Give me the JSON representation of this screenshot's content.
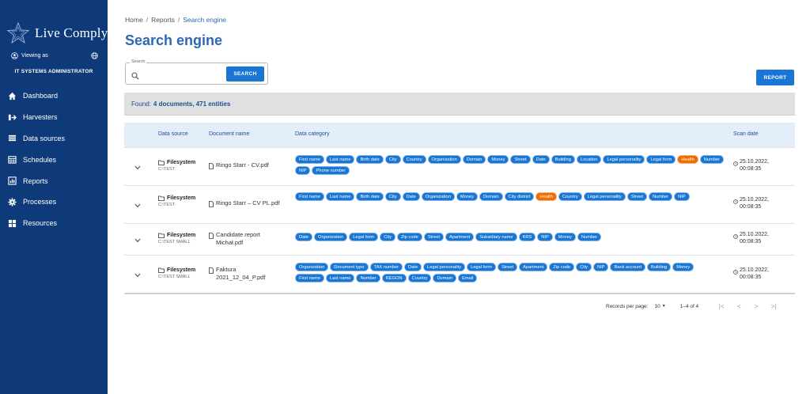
{
  "sidebar": {
    "brand": "Live Comply",
    "viewing_as": "Viewing as",
    "role": "IT SYSTEMS ADMINISTRATOR",
    "items": [
      {
        "label": "Dashboard",
        "icon": "home-icon"
      },
      {
        "label": "Harvesters",
        "icon": "harvesters-icon"
      },
      {
        "label": "Data sources",
        "icon": "list-icon"
      },
      {
        "label": "Schedules",
        "icon": "calendar-icon"
      },
      {
        "label": "Reports",
        "icon": "report-icon"
      },
      {
        "label": "Processes",
        "icon": "gear-icon"
      },
      {
        "label": "Resources",
        "icon": "grid-icon"
      }
    ]
  },
  "breadcrumb": {
    "home": "Home",
    "reports": "Reports",
    "current": "Search engine",
    "sep": "/"
  },
  "page_title": "Search engine",
  "search": {
    "legend": "Search",
    "value": "",
    "button": "SEARCH"
  },
  "report_button": "REPORT",
  "found": {
    "prefix": "Found:",
    "summary": "4 documents, 471 entities"
  },
  "table": {
    "headers": {
      "data_source": "Data source",
      "document_name": "Document name",
      "data_category": "Data category",
      "scan_date": "Scan date"
    },
    "rows": [
      {
        "source": "Filesystem",
        "path": "C:\\TEST",
        "doc_name": "Ringo Starr - CV.pdf",
        "categories": [
          "First name",
          "Last name",
          "Birth date",
          "City",
          "Country",
          "Organization",
          "Domain",
          "Money",
          "Street",
          "Date",
          "Building",
          "Location",
          "Legal personality",
          "Legal form",
          "Health",
          "Number",
          "NIP",
          "Phone number"
        ],
        "scan_date": "25.10.2022,",
        "scan_time": "00:08:35"
      },
      {
        "source": "Filesystem",
        "path": "C:\\TEST",
        "doc_name": "Ringo Starr – CV PL.pdf",
        "categories": [
          "First name",
          "Last name",
          "Birth date",
          "City",
          "Date",
          "Organization",
          "Money",
          "Domain",
          "City district",
          "Health",
          "Country",
          "Legal personality",
          "Street",
          "Number",
          "NIP"
        ],
        "scan_date": "25.10.2022,",
        "scan_time": "00:08:35"
      },
      {
        "source": "Filesystem",
        "path": "C:\\TEST SMALL",
        "doc_name": "Candidate report Michał.pdf",
        "categories": [
          "Date",
          "Organization",
          "Legal form",
          "City",
          "Zip code",
          "Street",
          "Apartment",
          "Subsidiary name",
          "KRS",
          "NIP",
          "Money",
          "Number"
        ],
        "scan_date": "25.10.2022,",
        "scan_time": "00:08:35"
      },
      {
        "source": "Filesystem",
        "path": "C:\\TEST SMALL",
        "doc_name": "Faktura 2021_12_04_P.pdf",
        "categories": [
          "Organization",
          "Document type",
          "TAX number",
          "Date",
          "Legal personality",
          "Legal form",
          "Street",
          "Apartment",
          "Zip code",
          "City",
          "NIP",
          "Bank account",
          "Building",
          "Money",
          "First name",
          "Last name",
          "Number",
          "REGON",
          "Country",
          "Domain",
          "Email"
        ],
        "scan_date": "25.10.2022,",
        "scan_time": "00:08:35"
      }
    ]
  },
  "pagination": {
    "rows_label": "Records per page:",
    "rows_value": "10",
    "range": "1–4 of 4",
    "first": "|<",
    "prev": "<",
    "next": ">",
    "last": ">|"
  },
  "colors": {
    "sidebar": "#0e3a7a",
    "accent": "#1976d2",
    "title": "#2d68b3",
    "health_chip": "#ef6c00"
  }
}
